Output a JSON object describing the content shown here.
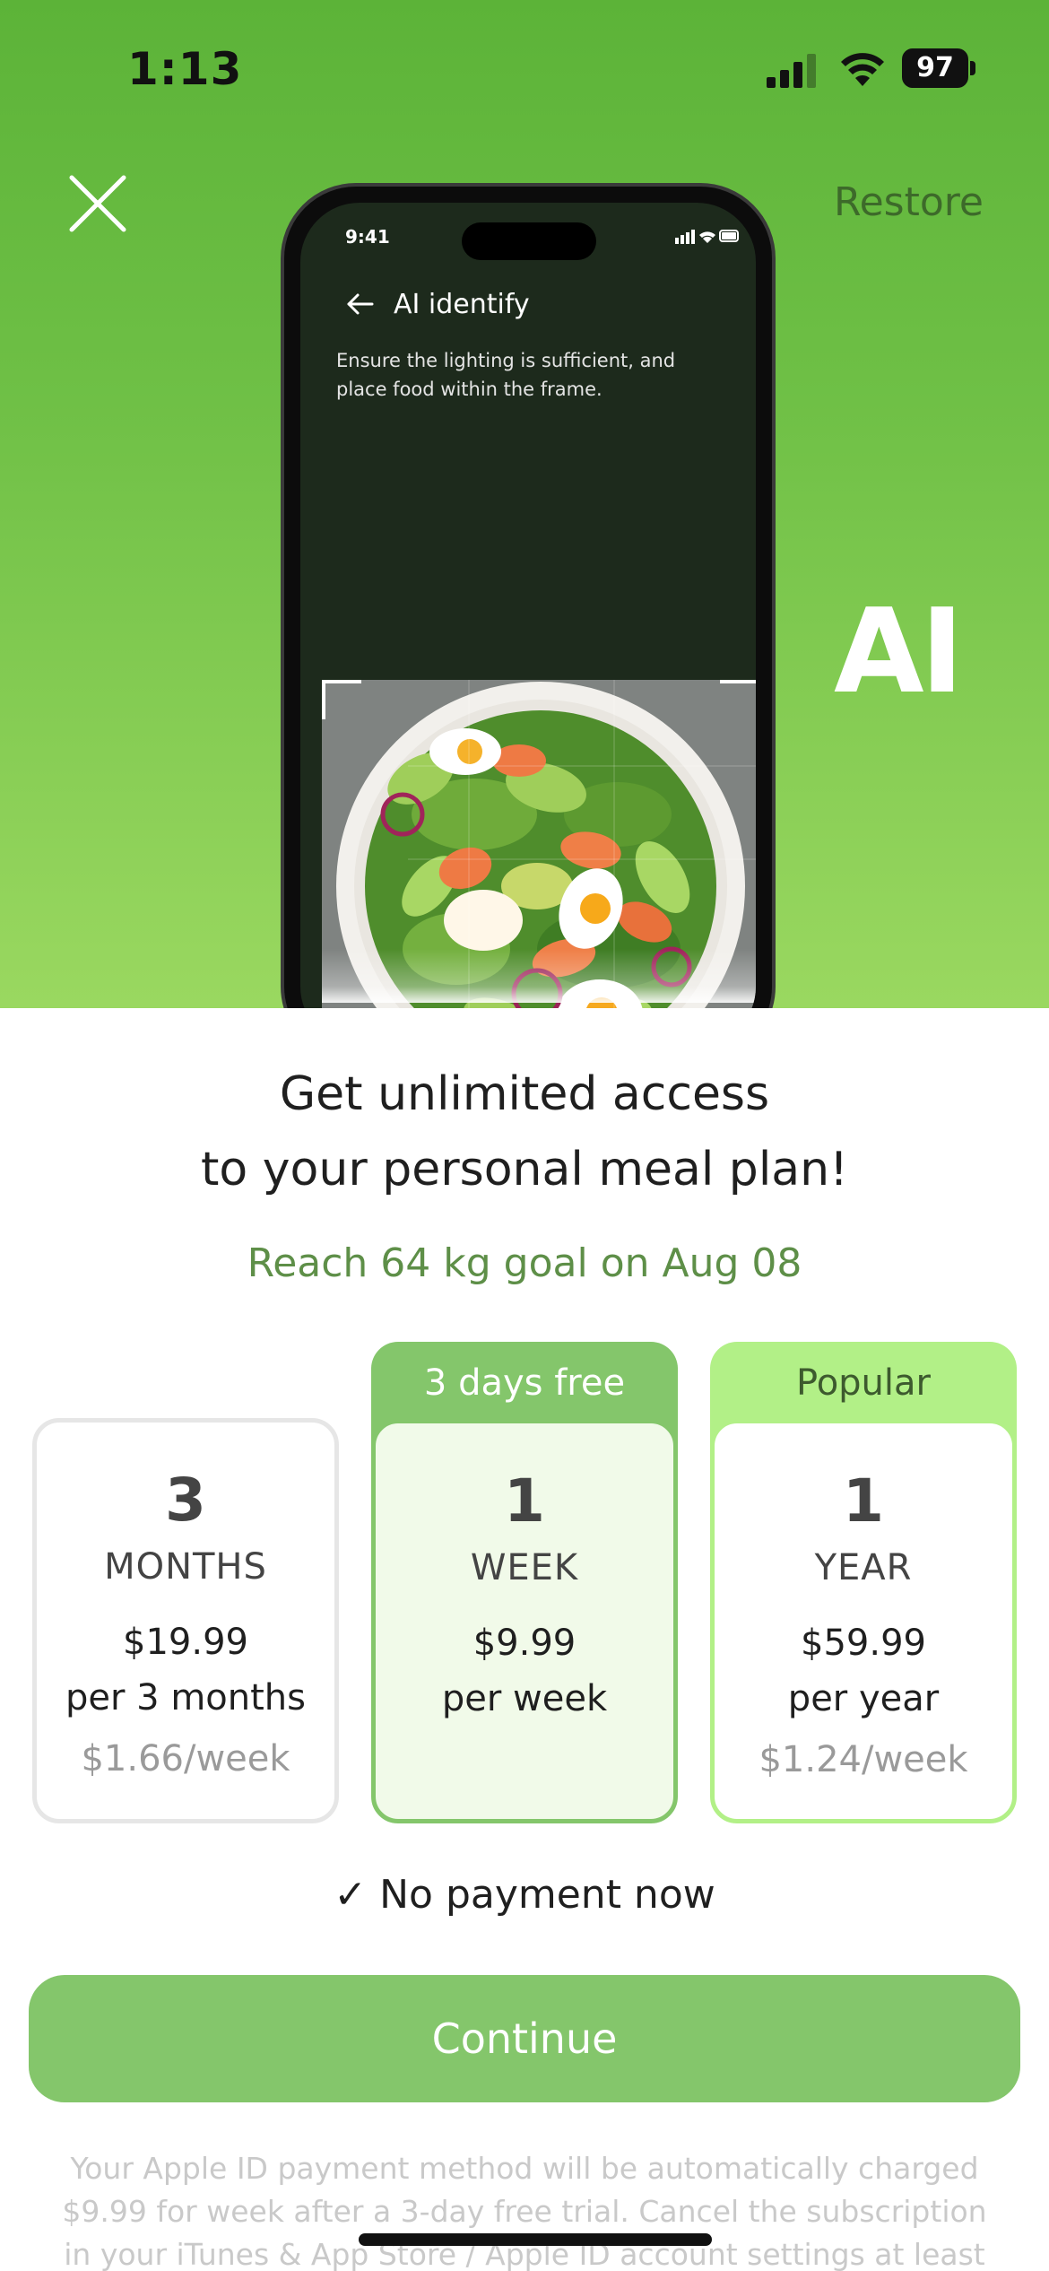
{
  "status_bar": {
    "time": "1:13",
    "battery": "97",
    "icons": [
      "cellular-signal-icon",
      "wifi-icon",
      "battery-icon"
    ]
  },
  "hero": {
    "close_icon": "close-icon",
    "restore_label": "Restore",
    "ai_badge": "AI",
    "phone_mockup": {
      "time": "9:41",
      "back_icon": "arrow-left-icon",
      "title": "AI identify",
      "hint": "Ensure the lighting is sufficient, and place food within the frame.",
      "image": "salad-bowl-photo"
    }
  },
  "headline": {
    "line1": "Get unlimited access",
    "line2": "to your personal meal plan!"
  },
  "goal": "Reach 64 kg goal on Aug 08",
  "plans": [
    {
      "tag": "",
      "number": "3",
      "unit": "MONTHS",
      "price": "$19.99",
      "period": "per 3 months",
      "weekly": "$1.66/week",
      "selected": false
    },
    {
      "tag": "3 days free",
      "number": "1",
      "unit": "WEEK",
      "price": "$9.99",
      "period": "per week",
      "weekly": "",
      "selected": true
    },
    {
      "tag": "Popular",
      "number": "1",
      "unit": "YEAR",
      "price": "$59.99",
      "period": "per year",
      "weekly": "$1.24/week",
      "selected": false
    }
  ],
  "no_payment": "✓ No payment now",
  "continue_label": "Continue",
  "legal": "Your Apple ID payment method will be automatically charged $9.99 for week after a 3-day free trial. Cancel the subscription in your iTunes & App Store / Apple ID account settings at least",
  "colors": {
    "hero_green": "#6fc046",
    "accent_green": "#84c66b",
    "popular_green": "#b2f087",
    "goal_text": "#5e8f48"
  }
}
